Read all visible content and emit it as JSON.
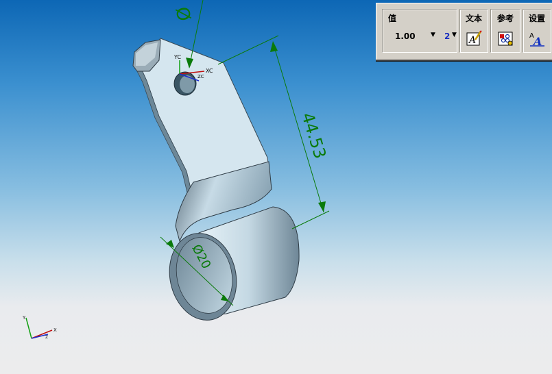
{
  "toolbar": {
    "value_group": {
      "label": "值",
      "value": "1.00",
      "precision": "2"
    },
    "text_group": {
      "label": "文本"
    },
    "reference_group": {
      "label": "参考"
    },
    "settings_group": {
      "label": "设置"
    }
  },
  "drawing": {
    "dimension_linear": "44.53",
    "dimension_diameter": "Ø20",
    "top_diameter_symbol": "Ø",
    "wcs_labels": {
      "y": "YC",
      "x": "XC",
      "z": "ZC"
    },
    "abs_triad_labels": {
      "y": "Y",
      "x": "X",
      "z": "Z"
    }
  },
  "colors": {
    "background_top": "#0d67b5",
    "background_bottom": "#ececed",
    "dimension_green": "#0a7a0a",
    "part_face": "#d5e6ef",
    "toolbar_bg": "#d4d0c8"
  }
}
